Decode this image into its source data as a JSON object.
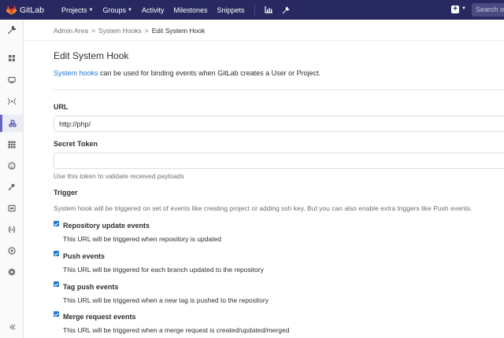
{
  "topbar": {
    "app_name": "GitLab",
    "nav": [
      {
        "label": "Projects",
        "has_dropdown": true
      },
      {
        "label": "Groups",
        "has_dropdown": true
      },
      {
        "label": "Activity",
        "has_dropdown": false
      },
      {
        "label": "Milestones",
        "has_dropdown": false
      },
      {
        "label": "Snippets",
        "has_dropdown": false
      }
    ],
    "icons": [
      "chart-icon",
      "wrench-icon",
      "plus-icon",
      "chevron-down-icon"
    ],
    "search_placeholder": "Search o",
    "colors": {
      "background": "#292961",
      "accent": "#fc6d26"
    }
  },
  "sidebar": {
    "icons": [
      "wrench-icon",
      "dashboard-icon",
      "monitor-icon",
      "broadcast-icon",
      "hooks-icon",
      "apps-icon",
      "abuse-icon",
      "key-icon",
      "labels-icon",
      "spam-icon",
      "appearance-icon",
      "settings-icon"
    ],
    "active_index": 4,
    "active_color": "#6666c4"
  },
  "breadcrumb": {
    "items": [
      "Admin Area",
      "System Hooks",
      "Edit System Hook"
    ],
    "separator": ">"
  },
  "page": {
    "title": "Edit System Hook",
    "intro_link": "System hooks",
    "intro_text": " can be used for binding events when GitLab creates a User or Project.",
    "link_color": "#1f78d1"
  },
  "form": {
    "url_label": "URL",
    "url_value": "http://php/",
    "token_label": "Secret Token",
    "token_value": "",
    "token_help": "Use this token to validate received payloads",
    "trigger_label": "Trigger",
    "trigger_help": "System hook will be triggered on set of events like creating project or adding ssh key. But you can also enable extra triggers like Push events.",
    "triggers": [
      {
        "label": "Repository update events",
        "desc": "This URL will be triggered when repository is updated",
        "checked": true
      },
      {
        "label": "Push events",
        "desc": "This URL will be triggered for each branch updated to the repository",
        "checked": true
      },
      {
        "label": "Tag push events",
        "desc": "This URL will be triggered when a new tag is pushed to the repository",
        "checked": true
      },
      {
        "label": "Merge request events",
        "desc": "This URL will be triggered when a merge request is created/updated/merged",
        "checked": true
      }
    ]
  }
}
